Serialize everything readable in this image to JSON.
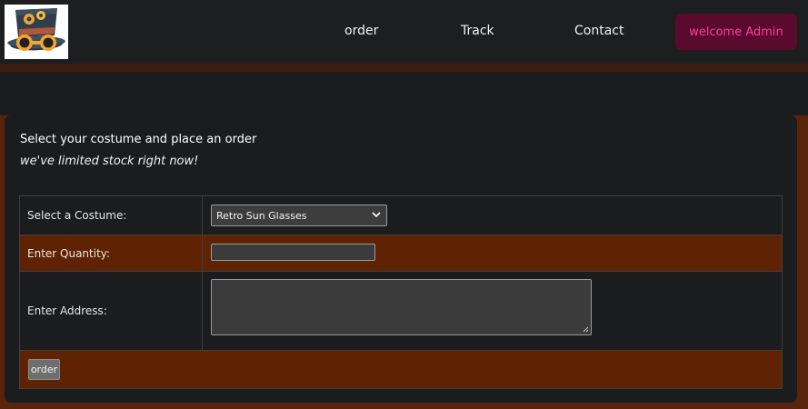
{
  "nav": {
    "logo_icon": "steampunk-top-hat-goggles-logo",
    "links": [
      {
        "label": "order"
      },
      {
        "label": "Track"
      },
      {
        "label": "Contact"
      }
    ],
    "welcome_label": "welcome Admin"
  },
  "form": {
    "heading": "Select your costume and place an order",
    "subheading": "we've limited stock right now!",
    "rows": [
      {
        "label": "Select a Costume:",
        "selected": "Retro Sun Glasses"
      },
      {
        "label": "Enter Quantity:",
        "value": ""
      },
      {
        "label": "Enter Address:",
        "value": ""
      }
    ],
    "submit_label": "order"
  },
  "colors": {
    "background": "#1b1c1e",
    "brown_accent": "#5f2303",
    "welcome_bg": "#5a0a2c",
    "welcome_text": "#ff3aa6"
  }
}
